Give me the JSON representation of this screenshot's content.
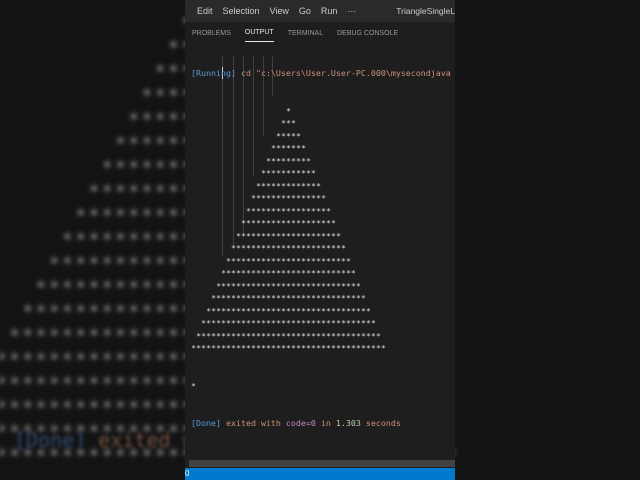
{
  "menu": {
    "edit": "Edit",
    "selection": "Selection",
    "view": "View",
    "go": "Go",
    "run": "Run",
    "more": "···",
    "title": "TriangleSingleL"
  },
  "panel_tabs": [
    "PROBLEMS",
    "OUTPUT",
    "TERMINAL",
    "DEBUG CONSOLE"
  ],
  "output": {
    "running_tag": "[Running]",
    "command": " cd \"c:\\Users\\User.User-PC.000\\mysecondjava",
    "triangle_rows": [
      "*",
      "***",
      "*****",
      "*******",
      "*********",
      "***********",
      "*************",
      "***************",
      "*****************",
      "*******************",
      "*********************",
      "***********************",
      "*************************",
      "***************************",
      "*****************************",
      "*******************************",
      "*********************************",
      "***********************************",
      "*************************************",
      "***************************************"
    ],
    "trailing_star": "*",
    "done_tag": "[Done]",
    "exited": " exited with ",
    "code": "code=0",
    "in": " in ",
    "time": "1.303",
    "seconds": " seconds"
  },
  "status": {
    "left": "0"
  },
  "colors": {
    "status_bar": "#007acc",
    "running": "#569cd6",
    "command": "#ce9178",
    "code": "#c586c0",
    "time": "#b5cea8"
  }
}
